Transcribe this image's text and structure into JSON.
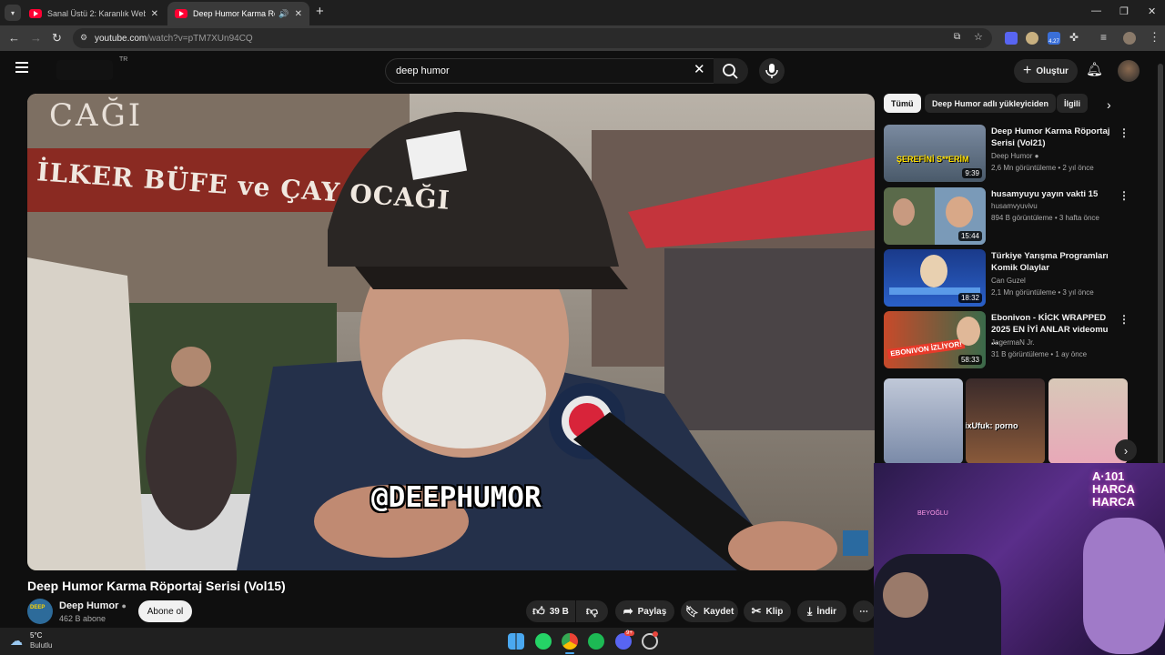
{
  "browser": {
    "tabs": [
      {
        "title": "Sanal Üstü 2: Karanlık Web | Fil",
        "active": false
      },
      {
        "title": "Deep Humor Karma Röportaj",
        "active": true
      }
    ],
    "new_tab": "+",
    "url_host": "youtube.com",
    "url_path": "/watch?v=pTM7XUn94CQ",
    "ext_badge": "4.27"
  },
  "youtube": {
    "region": "TR",
    "search_query": "deep humor",
    "create_label": "Oluştur",
    "video": {
      "overlay_text": "@DEEPHUMOR",
      "sign_text": "İLKER BÜFE ve ÇAY OCAĞI",
      "sign_top": "CAĞI",
      "title": "Deep Humor Karma Röportaj Serisi (Vol15)",
      "channel": "Deep Humor",
      "subscribers": "462 B abone",
      "subscribe_label": "Abone ol",
      "likes": "39 B",
      "share_label": "Paylaş",
      "save_label": "Kaydet",
      "clip_label": "Klip",
      "download_label": "İndir"
    },
    "chips": [
      "Tümü",
      "Deep Humor adlı yükleyiciden",
      "İlgili"
    ],
    "recommendations": [
      {
        "title": "Deep Humor Karma Röportaj Serisi (Vol21)",
        "channel": "Deep Humor",
        "meta": "2,6 Mn görüntüleme • 2 yıl önce",
        "duration": "9:39",
        "thumb_caption": "ŞEREFİNİ S**ERİM"
      },
      {
        "title": "husamyuyu yayın vakti 15",
        "channel": "husamvyuvivu",
        "meta": "894 B görüntüleme • 3 hafta önce",
        "duration": "15:44",
        "thumb_caption": ""
      },
      {
        "title": "Türkiye Yarışma Programları Komik Olaylar",
        "channel": "Can Guzel",
        "meta": "2,1 Mn görüntüleme • 3 yıl önce",
        "duration": "18:32",
        "thumb_caption": ""
      },
      {
        "title": "Ebonivon - KİCK WRAPPED 2025 EN İYİ ANLAR videomu ...",
        "channel": "JagermaN Jr.",
        "meta": "31 B görüntüleme • 1 ay önce",
        "duration": "58:33",
        "thumb_caption": "EBONIVON İZLİYOR!"
      }
    ],
    "shorts_overlay": "MatrixUfuk: porno"
  },
  "webcam": {
    "sign": "A·101 HARCA HARCA",
    "neon": "BEYOĞLU"
  },
  "taskbar": {
    "temp": "5°C",
    "weather": "Bulutlu",
    "discord_badge": "9+"
  },
  "colors": {
    "accent_red": "#ff0033",
    "bg": "#0f0f0f",
    "pill": "#272727"
  }
}
